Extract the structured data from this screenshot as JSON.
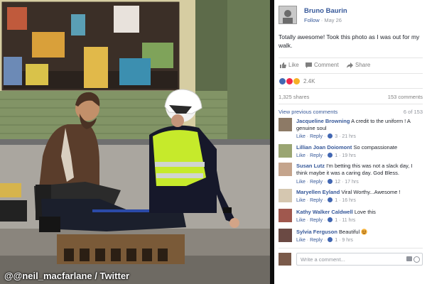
{
  "photo": {
    "credit": "@@neil_macfarlane / Twitter"
  },
  "post": {
    "author": "Bruno Baurin",
    "follow": "Follow",
    "date": "May 26",
    "meta_sep": "·",
    "text": "Totally awesome! Took this photo as I was out for my walk.",
    "actions": {
      "like": "Like",
      "comment": "Comment",
      "share": "Share"
    },
    "reactions": {
      "count": "2.4K"
    },
    "shares": "1,325 shares",
    "comments_count": "153 comments",
    "view_previous": "View previous comments",
    "paging": "6 of 153"
  },
  "comments": [
    {
      "author": "Jacqueline Browning",
      "text": "A credit to the uniform ! A genuine soul",
      "reply": "Reply",
      "likes": "3",
      "time": "21 hrs"
    },
    {
      "author": "Lillian Joan Doiomont",
      "text": "So compassionate",
      "reply": "Reply",
      "likes": "1",
      "time": "19 hrs"
    },
    {
      "author": "Susan Lutz",
      "text": "I'm betting this was not a slack day, I think maybe it was a caring day. God Bless.",
      "reply": "Reply",
      "likes": "12",
      "time": "17 hrs"
    },
    {
      "author": "Maryellen Eyland",
      "text": "Viral Worthy...Awesome !",
      "reply": "Reply",
      "likes": "1",
      "time": "16 hrs"
    },
    {
      "author": "Kathy Walker Caldwell",
      "text": "Love this",
      "reply": "Reply",
      "likes": "1",
      "time": "11 hrs"
    },
    {
      "author": "Sylvia Ferguson",
      "text": "Beautiful",
      "reply": "Reply",
      "likes": "1",
      "time": "9 hrs"
    }
  ],
  "like_label": "Like",
  "dot": "·",
  "write_comment": {
    "placeholder": "Write a comment..."
  },
  "colors": {
    "link": "#365899",
    "meta": "#90949c",
    "like_blue": "#4267b2"
  }
}
